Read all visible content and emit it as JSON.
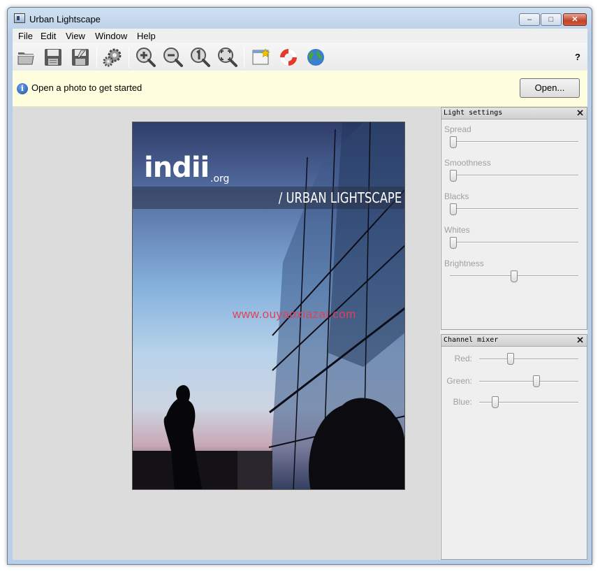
{
  "window": {
    "title": "Urban Lightscape",
    "min": "–",
    "max": "□",
    "close": "✕"
  },
  "menu": [
    "File",
    "Edit",
    "View",
    "Window",
    "Help"
  ],
  "toolbar": {
    "help": "?",
    "buttons": [
      {
        "icon": "open-folder-icon"
      },
      {
        "icon": "save-icon"
      },
      {
        "icon": "save-as-icon"
      },
      {
        "icon": "settings-icon"
      },
      {
        "icon": "zoom-in-icon"
      },
      {
        "icon": "zoom-out-icon"
      },
      {
        "icon": "zoom-actual-icon"
      },
      {
        "icon": "zoom-fit-icon"
      },
      {
        "icon": "new-window-icon"
      },
      {
        "icon": "lifebuoy-icon"
      },
      {
        "icon": "globe-icon"
      }
    ]
  },
  "infobar": {
    "message": "Open a photo to get started",
    "button": "Open..."
  },
  "photo": {
    "brand": "indii",
    "brand_suffix": ".org",
    "title": "/ URBAN LIGHTSCAPE"
  },
  "watermark": "www.ouyaoxiazai.com",
  "light_settings": {
    "title": "Light settings",
    "close": "✕",
    "sliders": [
      {
        "label": "Spread",
        "value": 0.0
      },
      {
        "label": "Smoothness",
        "value": 0.0
      },
      {
        "label": "Blacks",
        "value": 0.0
      },
      {
        "label": "Whites",
        "value": 0.0
      },
      {
        "label": "Brightness",
        "value": 0.5
      }
    ]
  },
  "channel_mixer": {
    "title": "Channel mixer",
    "close": "✕",
    "sliders": [
      {
        "label": "Red:",
        "value": 0.3
      },
      {
        "label": "Green:",
        "value": 0.58
      },
      {
        "label": "Blue:",
        "value": 0.14
      }
    ]
  },
  "colors": {
    "infobar": "#ffffe0",
    "canvas": "#dcdcdc",
    "watermark": "#e0405a"
  }
}
